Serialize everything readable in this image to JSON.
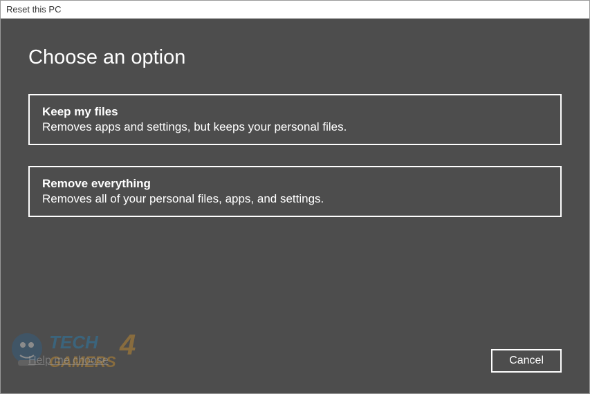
{
  "window": {
    "title": "Reset this PC"
  },
  "heading": "Choose an option",
  "options": [
    {
      "title": "Keep my files",
      "description": "Removes apps and settings, but keeps your personal files."
    },
    {
      "title": "Remove everything",
      "description": "Removes all of your personal files, apps, and settings."
    }
  ],
  "footer": {
    "help_link": "Help me choose",
    "cancel_label": "Cancel"
  },
  "watermark": {
    "text": "TECH 4 GAMERS"
  }
}
